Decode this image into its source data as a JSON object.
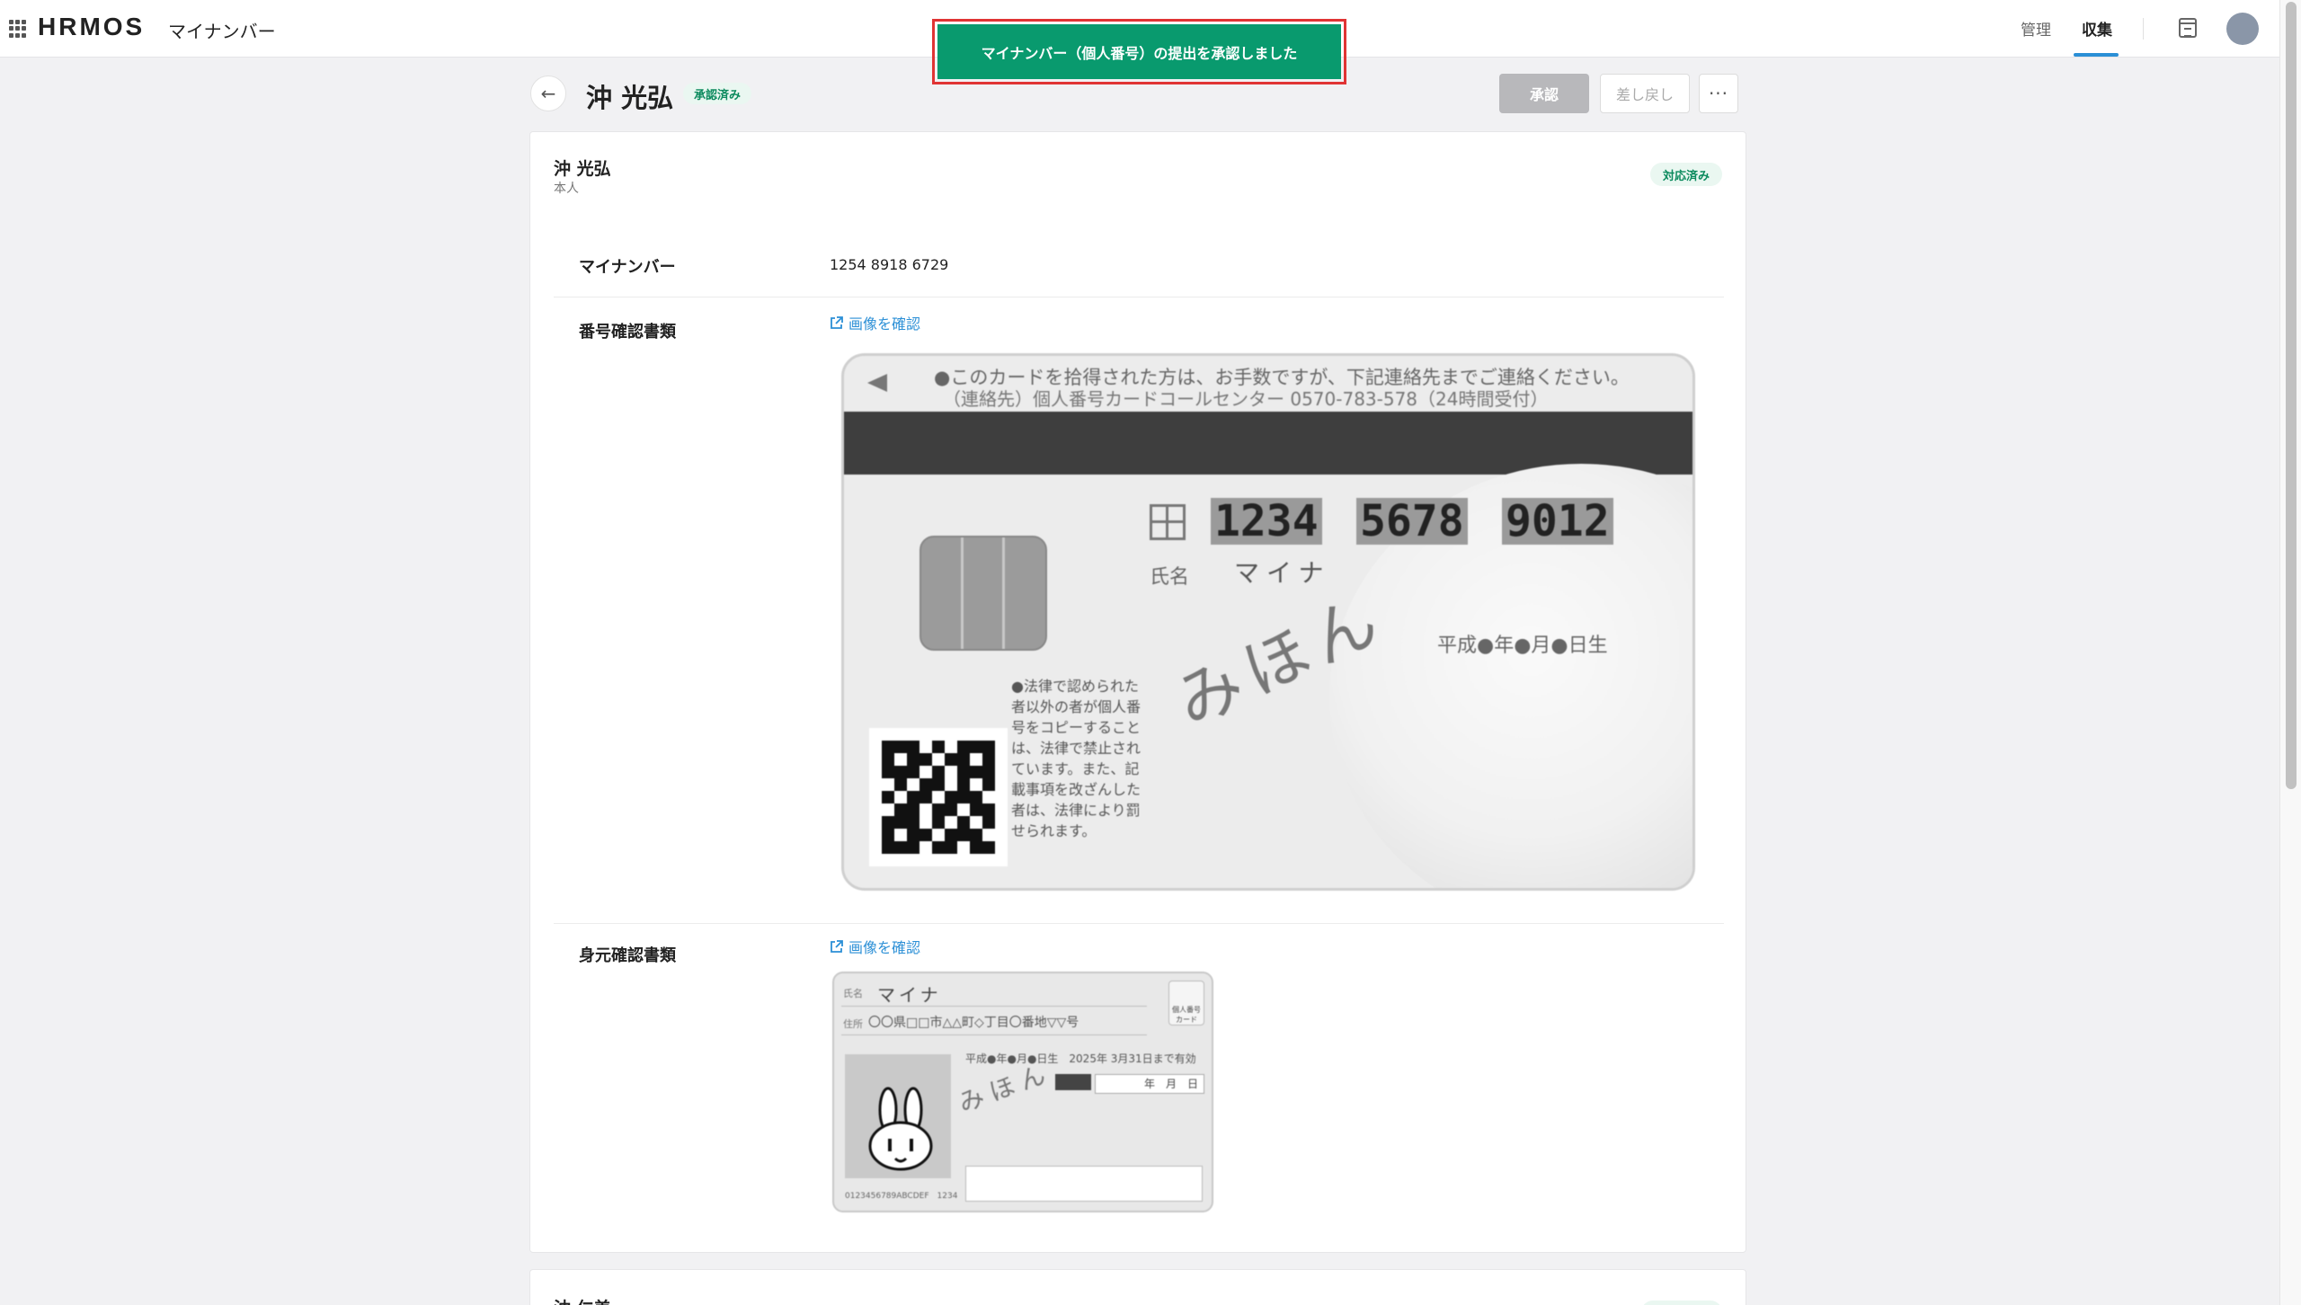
{
  "header": {
    "logo": "HRMOS",
    "app_name": "マイナンバー",
    "nav": {
      "manage": "管理",
      "collect": "収集"
    }
  },
  "toast": {
    "message": "マイナンバー（個人番号）の提出を承認しました"
  },
  "title_row": {
    "back_icon": "←",
    "name": "沖 光弘",
    "status_badge": "承認済み",
    "approve_label": "承認",
    "return_label": "差し戻し",
    "more_label": "···"
  },
  "card": {
    "name": "沖 光弘",
    "relation": "本人",
    "status": "対応済み",
    "rows": {
      "mynumber_label": "マイナンバー",
      "mynumber_value": "1254 8918 6729",
      "number_doc_label": "番号確認書類",
      "number_doc_link": "画像を確認",
      "identity_doc_label": "身元確認書類",
      "identity_doc_link": "画像を確認"
    },
    "mynumber_card_image": {
      "line1": "●このカードを拾得された方は、お手数ですが、下記連絡先までご連絡ください。",
      "line2": "（連絡先）個人番号カードコールセンター 0570-783-578（24時間受付）",
      "num1": "1234",
      "num2": "5678",
      "num3": "9012",
      "name_label": "氏名",
      "name": "マイナ",
      "signature": "みほん",
      "dob": "平成●年●月●日生",
      "notice": "●法律で認められた者以外の者が個人番号をコピーすることは、法律で禁止されています。また、記載事項を改ざんした者は、法律により罰せられます。"
    },
    "identity_card_image": {
      "name_label": "氏名",
      "name": "マイナ",
      "addr_label": "住所",
      "address": "〇〇県□□市△△町◇丁目〇番地▽▽号",
      "dob": "平成●年●月●日生　2025年 3月31日まで有効",
      "date_box": "年　月　日",
      "signature": "みほん",
      "number": "0123456789ABCDEF　1234",
      "corner": "個人番号カード"
    }
  },
  "next_card": {
    "name": "沖 仁美"
  }
}
